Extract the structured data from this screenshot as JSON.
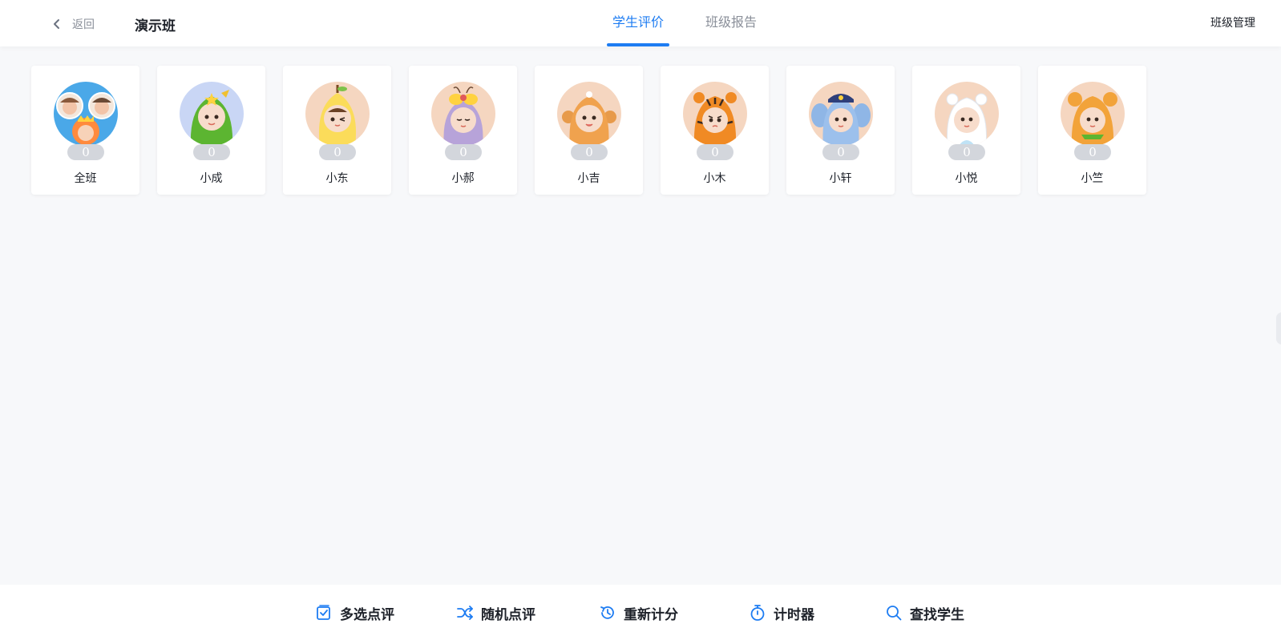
{
  "header": {
    "back_label": "返回",
    "class_name": "演示班",
    "tabs": [
      {
        "label": "学生评价",
        "active": true
      },
      {
        "label": "班级报告",
        "active": false
      }
    ],
    "manage_label": "班级管理",
    "accent_color": "#1d7cf2"
  },
  "students": [
    {
      "name": "全班",
      "score": "0",
      "avatar": "group-avatar"
    },
    {
      "name": "小成",
      "score": "0",
      "avatar": "green-dragon-costume"
    },
    {
      "name": "小东",
      "score": "0",
      "avatar": "pear-costume"
    },
    {
      "name": "小郝",
      "score": "0",
      "avatar": "butterfly-costume"
    },
    {
      "name": "小吉",
      "score": "0",
      "avatar": "monkey-costume"
    },
    {
      "name": "小木",
      "score": "0",
      "avatar": "tiger-costume"
    },
    {
      "name": "小轩",
      "score": "0",
      "avatar": "elephant-police-costume"
    },
    {
      "name": "小悦",
      "score": "0",
      "avatar": "polar-bear-costume"
    },
    {
      "name": "小竺",
      "score": "0",
      "avatar": "bear-costume"
    }
  ],
  "toolbar": {
    "items": [
      {
        "label": "多选点评",
        "icon": "checkbox-icon"
      },
      {
        "label": "随机点评",
        "icon": "shuffle-icon"
      },
      {
        "label": "重新计分",
        "icon": "history-icon"
      },
      {
        "label": "计时器",
        "icon": "stopwatch-icon"
      },
      {
        "label": "查找学生",
        "icon": "search-icon"
      }
    ]
  }
}
